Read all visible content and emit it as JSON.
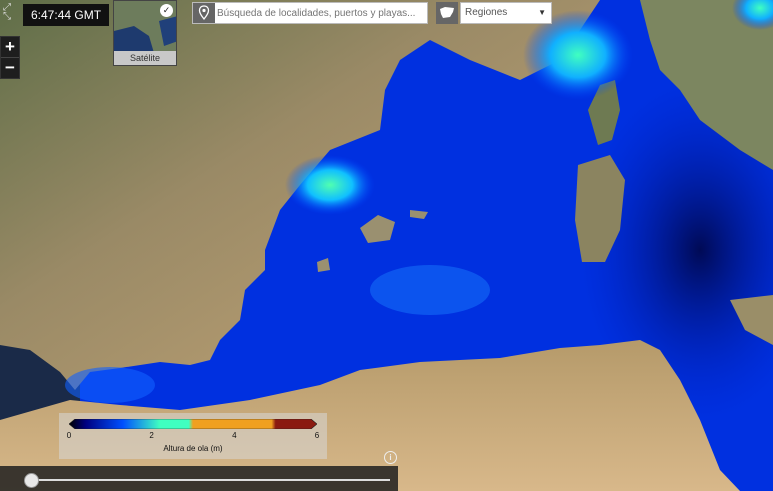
{
  "clock": {
    "time": "6:47:44 GMT"
  },
  "layer": {
    "label": "Satélite",
    "selected_icon": "check-icon"
  },
  "search": {
    "placeholder": "Búsqueda de localidades, puertos y playas...",
    "value": ""
  },
  "regions": {
    "selected": "Regiones",
    "icon": "spain-map-icon"
  },
  "zoom": {
    "in_label": "+",
    "out_label": "−"
  },
  "legend": {
    "ticks": [
      "0",
      "2",
      "4",
      "6"
    ],
    "title": "Altura de ola (m)",
    "stops": [
      {
        "value": 0,
        "color": "#000000"
      },
      {
        "value": 0.4,
        "color": "#000080"
      },
      {
        "value": 1.3,
        "color": "#0050ff"
      },
      {
        "value": 2.2,
        "color": "#40ffc0"
      },
      {
        "value": 2.9,
        "color": "#40ffc0"
      },
      {
        "value": 3.0,
        "color": "#f0a020"
      },
      {
        "value": 4.9,
        "color": "#f0a020"
      },
      {
        "value": 5.0,
        "color": "#8a1a10"
      },
      {
        "value": 6.0,
        "color": "#8a1a10"
      }
    ]
  },
  "timeline": {
    "progress": 0.0
  },
  "colors": {
    "land": "#7a8a5a",
    "sea_deep": "#00106e",
    "sea_mid": "#0040ff",
    "sea_light": "#00c0ff",
    "wave_high": "#40ffc0"
  }
}
